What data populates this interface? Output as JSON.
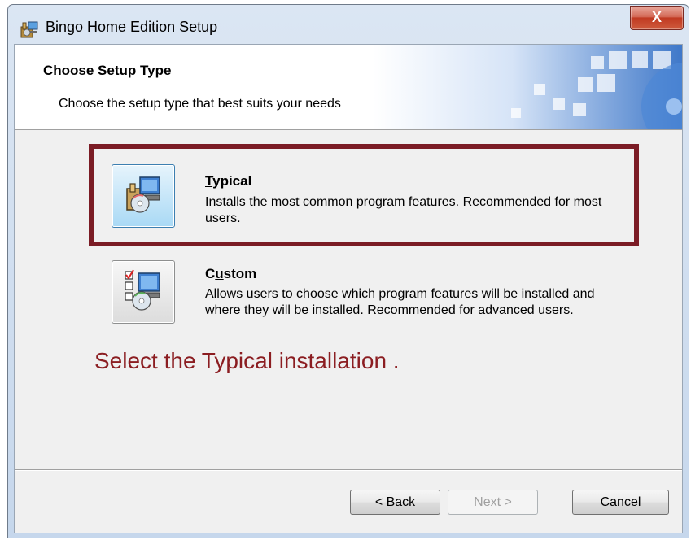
{
  "window": {
    "title": "Bingo Home Edition Setup",
    "close_label": "X"
  },
  "header": {
    "title": "Choose Setup Type",
    "subtitle": "Choose the setup type that best suits your needs"
  },
  "options": [
    {
      "title": "Typical",
      "hotkey_prefix": "",
      "hotkey": "T",
      "rest": "ypical",
      "description": "Installs the most common program features. Recommended for most users.",
      "selected": true
    },
    {
      "title": "Custom",
      "hotkey_prefix": "C",
      "hotkey": "u",
      "rest": "stom",
      "description": "Allows users to choose which program features will be installed and where they will be installed. Recommended for advanced users.",
      "selected": false
    }
  ],
  "annotation": "Select the Typical installation .",
  "buttons": {
    "back": {
      "prefix": "< ",
      "hotkey": "B",
      "rest": "ack",
      "enabled": true
    },
    "next": {
      "hotkey": "N",
      "rest": "ext >",
      "enabled": false
    },
    "cancel": {
      "label": "Cancel",
      "enabled": true
    }
  },
  "colors": {
    "highlight": "#7b1c25",
    "annotation": "#8b1d21",
    "close": "#c03a22"
  }
}
